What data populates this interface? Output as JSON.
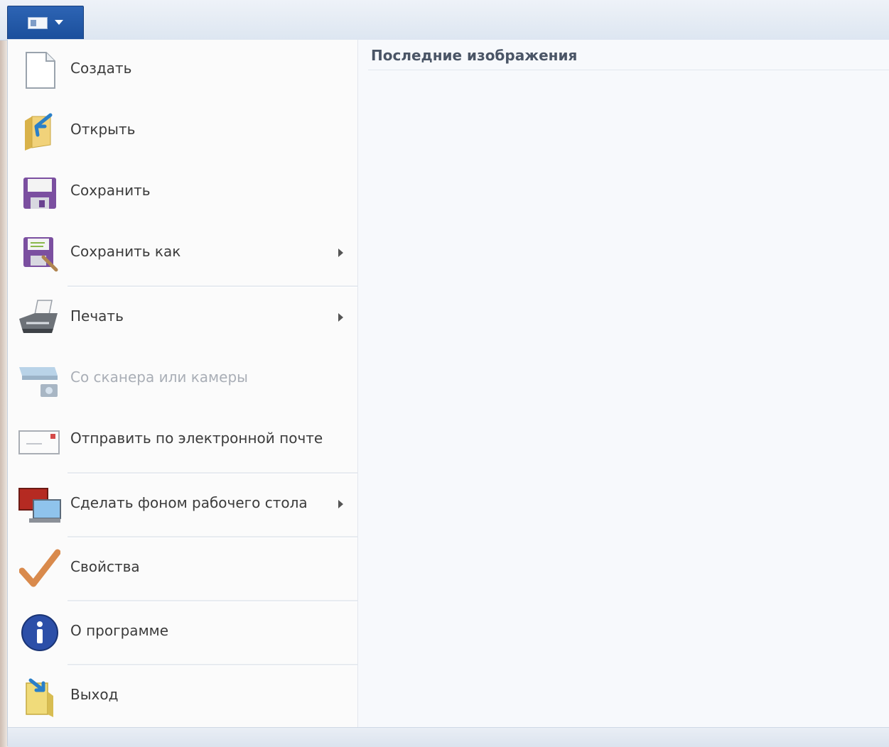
{
  "app_button": {
    "icon": "paint-menu-icon"
  },
  "recent": {
    "title": "Последние изображения"
  },
  "menu": {
    "items": [
      {
        "label": "Создать",
        "icon": "new-document-icon",
        "submenu": false,
        "enabled": true
      },
      {
        "label": "Открыть",
        "icon": "open-folder-icon",
        "submenu": false,
        "enabled": true
      },
      {
        "label": "Сохранить",
        "icon": "save-disk-icon",
        "submenu": false,
        "enabled": true
      },
      {
        "label": "Сохранить как",
        "icon": "save-as-icon",
        "submenu": true,
        "enabled": true
      },
      {
        "label": "Печать",
        "icon": "printer-icon",
        "submenu": true,
        "enabled": true
      },
      {
        "label": "Со сканера или камеры",
        "icon": "scanner-camera-icon",
        "submenu": false,
        "enabled": false
      },
      {
        "label": "Отправить по электронной почте",
        "icon": "email-icon",
        "submenu": false,
        "enabled": true
      },
      {
        "label": "Сделать фоном рабочего стола",
        "icon": "desktop-background-icon",
        "submenu": true,
        "enabled": true
      },
      {
        "label": "Свойства",
        "icon": "checkmark-icon",
        "submenu": false,
        "enabled": true
      },
      {
        "label": "О программе",
        "icon": "info-icon",
        "submenu": false,
        "enabled": true
      },
      {
        "label": "Выход",
        "icon": "exit-icon",
        "submenu": false,
        "enabled": true
      }
    ]
  }
}
